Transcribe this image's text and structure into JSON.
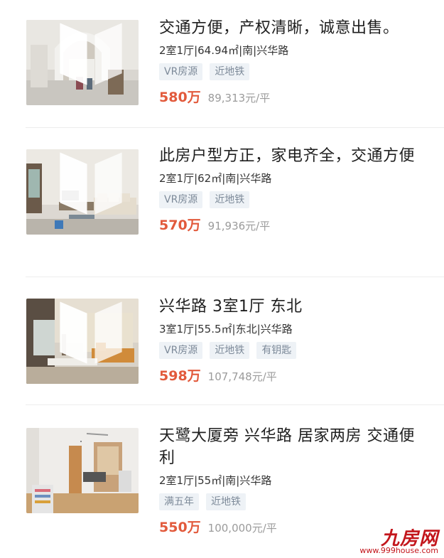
{
  "listings": [
    {
      "title": "交通方便，产权清晰，诚意出售。",
      "meta": "2室1厅|64.94㎡|南|兴华路",
      "tags": [
        "VR房源",
        "近地铁"
      ],
      "price": "580万",
      "unit_price": "89,313元/平",
      "vr": true
    },
    {
      "title": "此房户型方正，家电齐全，交通方便",
      "meta": "2室1厅|62㎡|南|兴华路",
      "tags": [
        "VR房源",
        "近地铁"
      ],
      "price": "570万",
      "unit_price": "91,936元/平",
      "vr": true
    },
    {
      "title": "兴华路 3室1厅 东北",
      "meta": "3室1厅|55.5㎡|东北|兴华路",
      "tags": [
        "VR房源",
        "近地铁",
        "有钥匙"
      ],
      "price": "598万",
      "unit_price": "107,748元/平",
      "vr": true
    },
    {
      "title": "天鹭大厦旁 兴华路 居家两房 交通便利",
      "meta": "2室1厅|55㎡|南|兴华路",
      "tags": [
        "满五年",
        "近地铁"
      ],
      "price": "550万",
      "unit_price": "100,000元/平",
      "vr": false
    }
  ],
  "watermark": {
    "logo": "九房网",
    "url": "www.999house.com"
  },
  "colors": {
    "price": "#e25a3c",
    "tag_text": "#7d8a99",
    "tag_bg": "#eef2f6",
    "watermark": "#c3161c"
  }
}
